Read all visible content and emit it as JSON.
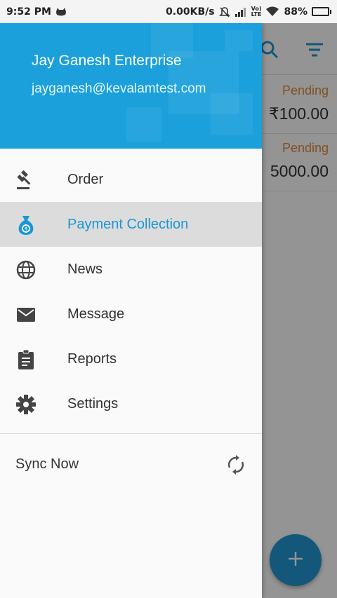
{
  "status_bar": {
    "time": "9:52 PM",
    "network_speed": "0.00KB/s",
    "lte_label_top": "Vo)",
    "lte_label_bottom": "LTE",
    "battery_text": "88%",
    "battery_level": 0.88,
    "icons": [
      "cat-icon",
      "silent-bell-icon",
      "signal-icon",
      "wifi-icon",
      "battery-charging-icon"
    ]
  },
  "drawer": {
    "header": {
      "company_name": "Jay Ganesh Enterprise",
      "email": "jayganesh@kevalamtest.com",
      "background_color": "#1ba0db"
    },
    "menu_items": [
      {
        "label": "Order",
        "icon": "gavel-icon",
        "active": false
      },
      {
        "label": "Payment Collection",
        "icon": "money-bag-icon",
        "active": true
      },
      {
        "label": "News",
        "icon": "globe-icon",
        "active": false
      },
      {
        "label": "Message",
        "icon": "envelope-icon",
        "active": false
      },
      {
        "label": "Reports",
        "icon": "clipboard-icon",
        "active": false
      },
      {
        "label": "Settings",
        "icon": "gear-icon",
        "active": false
      }
    ],
    "sync": {
      "label": "Sync Now",
      "icon": "sync-icon"
    }
  },
  "background_app": {
    "toolbar_icons": [
      "search-icon",
      "filter-icon"
    ],
    "rows": [
      {
        "status": "Pending",
        "amount": "₹100.00"
      },
      {
        "status": "Pending",
        "amount": "5000.00"
      }
    ],
    "fab_icon": "plus-icon"
  },
  "colors": {
    "accent": "#1a96d4",
    "pending": "#e08a3a",
    "fab": "#2196d3"
  }
}
